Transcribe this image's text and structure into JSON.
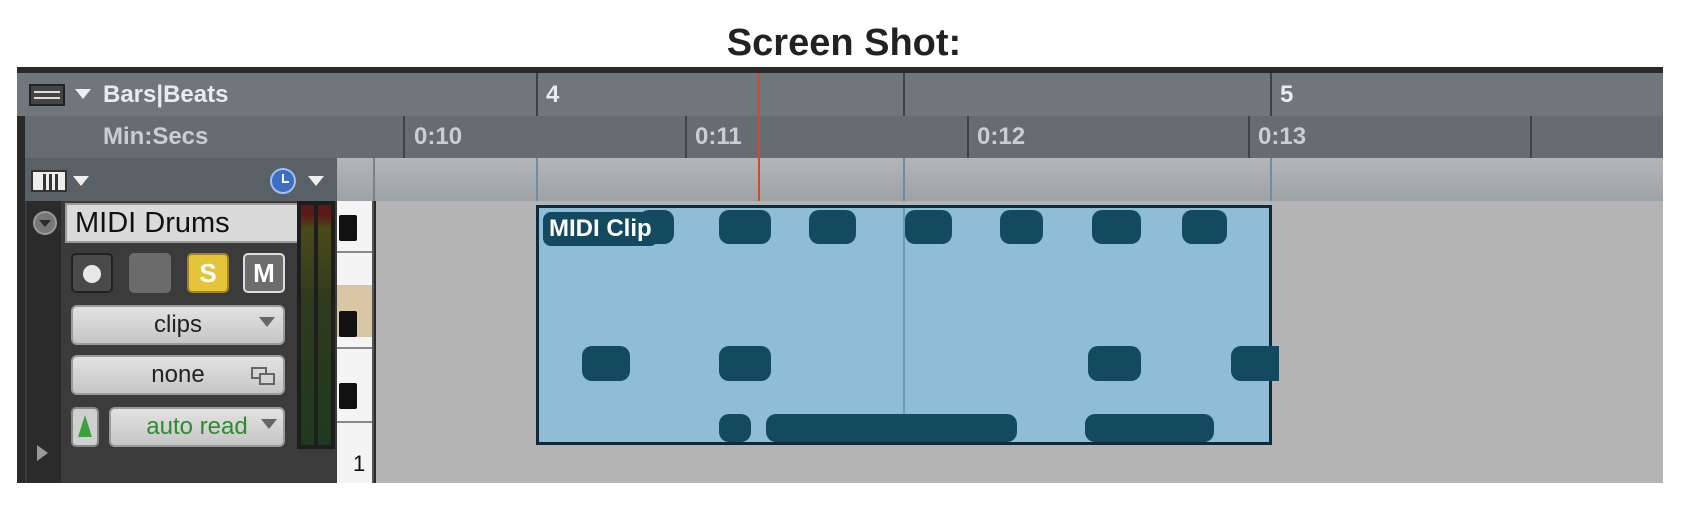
{
  "caption": "Screen Shot:",
  "rulers": {
    "bars_beats_label": "Bars|Beats",
    "min_secs_label": "Min:Secs",
    "bar_numbers": [
      "4",
      "5"
    ],
    "time_labels": [
      "0:10",
      "0:11",
      "0:12",
      "0:13"
    ]
  },
  "track": {
    "name": "MIDI Drums",
    "solo_label": "S",
    "mute_label": "M",
    "view_selector": "clips",
    "input_selector": "none",
    "automation_mode": "auto read",
    "keyboard_octave": "1"
  },
  "clip": {
    "name": "MIDI Clip"
  },
  "colors": {
    "clip_fill": "#8fbdd8",
    "note_fill": "#134a60",
    "playhead": "#d9452e",
    "automation_text": "#2e8b2e"
  }
}
